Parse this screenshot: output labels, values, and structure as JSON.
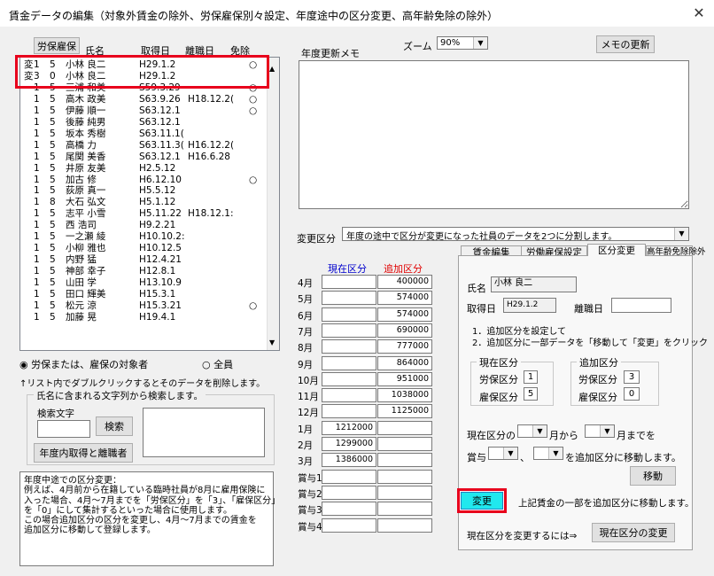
{
  "window": {
    "title": "賃金データの編集（対象外賃金の除外、労保雇保別々設定、年度途中の区分変更、高年齢免除の除外）",
    "close_glyph": "✕"
  },
  "list": {
    "toggle_button": "労保雇保",
    "headers": {
      "name": "氏名",
      "acquired": "取得日",
      "left": "離職日",
      "exempt": "免除"
    },
    "rows": [
      {
        "flag": "変",
        "a": "1",
        "b": "5",
        "name": "小林 良二",
        "acquired": "H29.1.2",
        "left": "",
        "exempt": "○"
      },
      {
        "flag": "変",
        "a": "3",
        "b": "0",
        "name": "小林 良二",
        "acquired": "H29.1.2",
        "left": "",
        "exempt": ""
      },
      {
        "flag": "",
        "a": "1",
        "b": "5",
        "name": "三浦 和美",
        "acquired": "S59.3.29",
        "left": "",
        "exempt": "○"
      },
      {
        "flag": "",
        "a": "1",
        "b": "5",
        "name": "高木 政美",
        "acquired": "S63.9.26",
        "left": "H18.12.2(",
        "exempt": "○"
      },
      {
        "flag": "",
        "a": "1",
        "b": "5",
        "name": "伊藤 順一",
        "acquired": "S63.12.1",
        "left": "",
        "exempt": "○"
      },
      {
        "flag": "",
        "a": "1",
        "b": "5",
        "name": "後藤 純男",
        "acquired": "S63.12.1",
        "left": "",
        "exempt": ""
      },
      {
        "flag": "",
        "a": "1",
        "b": "5",
        "name": "坂本 秀樹",
        "acquired": "S63.11.1(",
        "left": "",
        "exempt": ""
      },
      {
        "flag": "",
        "a": "1",
        "b": "5",
        "name": "高橋 力",
        "acquired": "S63.11.3(",
        "left": "H16.12.2(",
        "exempt": ""
      },
      {
        "flag": "",
        "a": "1",
        "b": "5",
        "name": "尾関 美香",
        "acquired": "S63.12.1",
        "left": "H16.6.28",
        "exempt": ""
      },
      {
        "flag": "",
        "a": "1",
        "b": "5",
        "name": "井原 友美",
        "acquired": "H2.5.12",
        "left": "",
        "exempt": ""
      },
      {
        "flag": "",
        "a": "1",
        "b": "5",
        "name": "加古 修",
        "acquired": "H6.12.10",
        "left": "",
        "exempt": "○"
      },
      {
        "flag": "",
        "a": "1",
        "b": "5",
        "name": "荻原 真一",
        "acquired": "H5.5.12",
        "left": "",
        "exempt": ""
      },
      {
        "flag": "",
        "a": "1",
        "b": "8",
        "name": "大石 弘文",
        "acquired": "H5.1.12",
        "left": "",
        "exempt": ""
      },
      {
        "flag": "",
        "a": "1",
        "b": "5",
        "name": "志平 小雪",
        "acquired": "H5.11.22",
        "left": "H18.12.1:",
        "exempt": ""
      },
      {
        "flag": "",
        "a": "1",
        "b": "5",
        "name": "西 浩司",
        "acquired": "H9.2.21",
        "left": "",
        "exempt": ""
      },
      {
        "flag": "",
        "a": "1",
        "b": "5",
        "name": "一之瀬 綾",
        "acquired": "H10.10.2:",
        "left": "",
        "exempt": ""
      },
      {
        "flag": "",
        "a": "1",
        "b": "5",
        "name": "小柳 雅也",
        "acquired": "H10.12.5",
        "left": "",
        "exempt": ""
      },
      {
        "flag": "",
        "a": "1",
        "b": "5",
        "name": "内野 猛",
        "acquired": "H12.4.21",
        "left": "",
        "exempt": ""
      },
      {
        "flag": "",
        "a": "1",
        "b": "5",
        "name": "神部 幸子",
        "acquired": "H12.8.1",
        "left": "",
        "exempt": ""
      },
      {
        "flag": "",
        "a": "1",
        "b": "5",
        "name": "山田 学",
        "acquired": "H13.10.9",
        "left": "",
        "exempt": ""
      },
      {
        "flag": "",
        "a": "1",
        "b": "5",
        "name": "田口 輝美",
        "acquired": "H15.3.1",
        "left": "",
        "exempt": ""
      },
      {
        "flag": "",
        "a": "1",
        "b": "5",
        "name": "松元 涼",
        "acquired": "H15.3.21",
        "left": "",
        "exempt": "○"
      },
      {
        "flag": "",
        "a": "1",
        "b": "5",
        "name": "加藤 晃",
        "acquired": "H19.4.1",
        "left": "",
        "exempt": ""
      }
    ]
  },
  "filter": {
    "option_target": "労保または、雇保の対象者",
    "option_all": "全員",
    "delete_hint": "↑リスト内でダブルクリックするとそのデータを削除します。",
    "search_group": "氏名に含まれる文字列から検索します。",
    "search_label": "検索文字",
    "search_value": "",
    "search_button": "検索",
    "within_year_button": "年度内取得と離職者"
  },
  "note": {
    "lines": [
      "年度中途での区分変更：",
      "例えば、4月前から在籍している臨時社員が8月に雇用保険に",
      "入った場合、4月～7月までを「労保区分」を「3」、「雇保区分」",
      "を「0」にして集計するといった場合に使用します。",
      "この場合追加区分の区分を変更し、4月～7月までの賃金を",
      "追加区分に移動して登録します。"
    ]
  },
  "memo": {
    "label": "年度更新メモ",
    "zoom_label": "ズーム",
    "zoom_value": "90%",
    "update_button": "メモの更新",
    "content": ""
  },
  "change_type": {
    "label": "変更区分",
    "value": "年度の途中で区分が変更になった社員のデータを2つに分割します。"
  },
  "wages": {
    "current_header": "現在区分",
    "added_header": "追加区分",
    "rows": [
      {
        "label": "4月",
        "current": "",
        "added": "400000"
      },
      {
        "label": "5月",
        "current": "",
        "added": "574000"
      },
      {
        "label": "6月",
        "current": "",
        "added": "574000"
      },
      {
        "label": "7月",
        "current": "",
        "added": "690000"
      },
      {
        "label": "8月",
        "current": "",
        "added": "777000"
      },
      {
        "label": "9月",
        "current": "",
        "added": "864000"
      },
      {
        "label": "10月",
        "current": "",
        "added": "951000"
      },
      {
        "label": "11月",
        "current": "",
        "added": "1038000"
      },
      {
        "label": "12月",
        "current": "",
        "added": "1125000"
      },
      {
        "label": "1月",
        "current": "1212000",
        "added": ""
      },
      {
        "label": "2月",
        "current": "1299000",
        "added": ""
      },
      {
        "label": "3月",
        "current": "1386000",
        "added": ""
      },
      {
        "label": "賞与1",
        "current": "",
        "added": ""
      },
      {
        "label": "賞与2",
        "current": "",
        "added": ""
      },
      {
        "label": "賞与3",
        "current": "",
        "added": ""
      },
      {
        "label": "賞与4",
        "current": "",
        "added": ""
      }
    ]
  },
  "tabs": [
    "賃金編集",
    "労働雇保設定",
    "区分変更",
    "高年齢免除除外"
  ],
  "panel": {
    "name_label": "氏名",
    "name_value": "小林 良二",
    "acquired_label": "取得日",
    "acquired_value": "H29.1.2",
    "left_label": "離職日",
    "left_value": "",
    "instructions": [
      "1．追加区分を設定して",
      "2．追加区分に一部データを「移動して「変更」をクリック"
    ],
    "current_group": "現在区分",
    "added_group": "追加区分",
    "labor_label": "労保区分",
    "employ_label": "雇保区分",
    "current_labor": "1",
    "current_employ": "5",
    "added_labor": "3",
    "added_employ": "0",
    "range_prefix": "現在区分の",
    "range_from": "月から",
    "range_to": "月までを",
    "bonus_label": "賞与",
    "bonus_sep": "、",
    "bonus_suffix": "を追加区分に移動します。",
    "move_button": "移動",
    "change_button": "変更",
    "change_hint": "上記賃金の一部を追加区分に移動します。",
    "change_current_hint": "現在区分を変更するには⇒",
    "change_current_button": "現在区分の変更"
  },
  "colors": {
    "highlight_red": "#e8001c",
    "change_button_bg": "#20e8ee",
    "wage_header_blue": "#0000cc",
    "wage_header_red": "#e00000"
  }
}
